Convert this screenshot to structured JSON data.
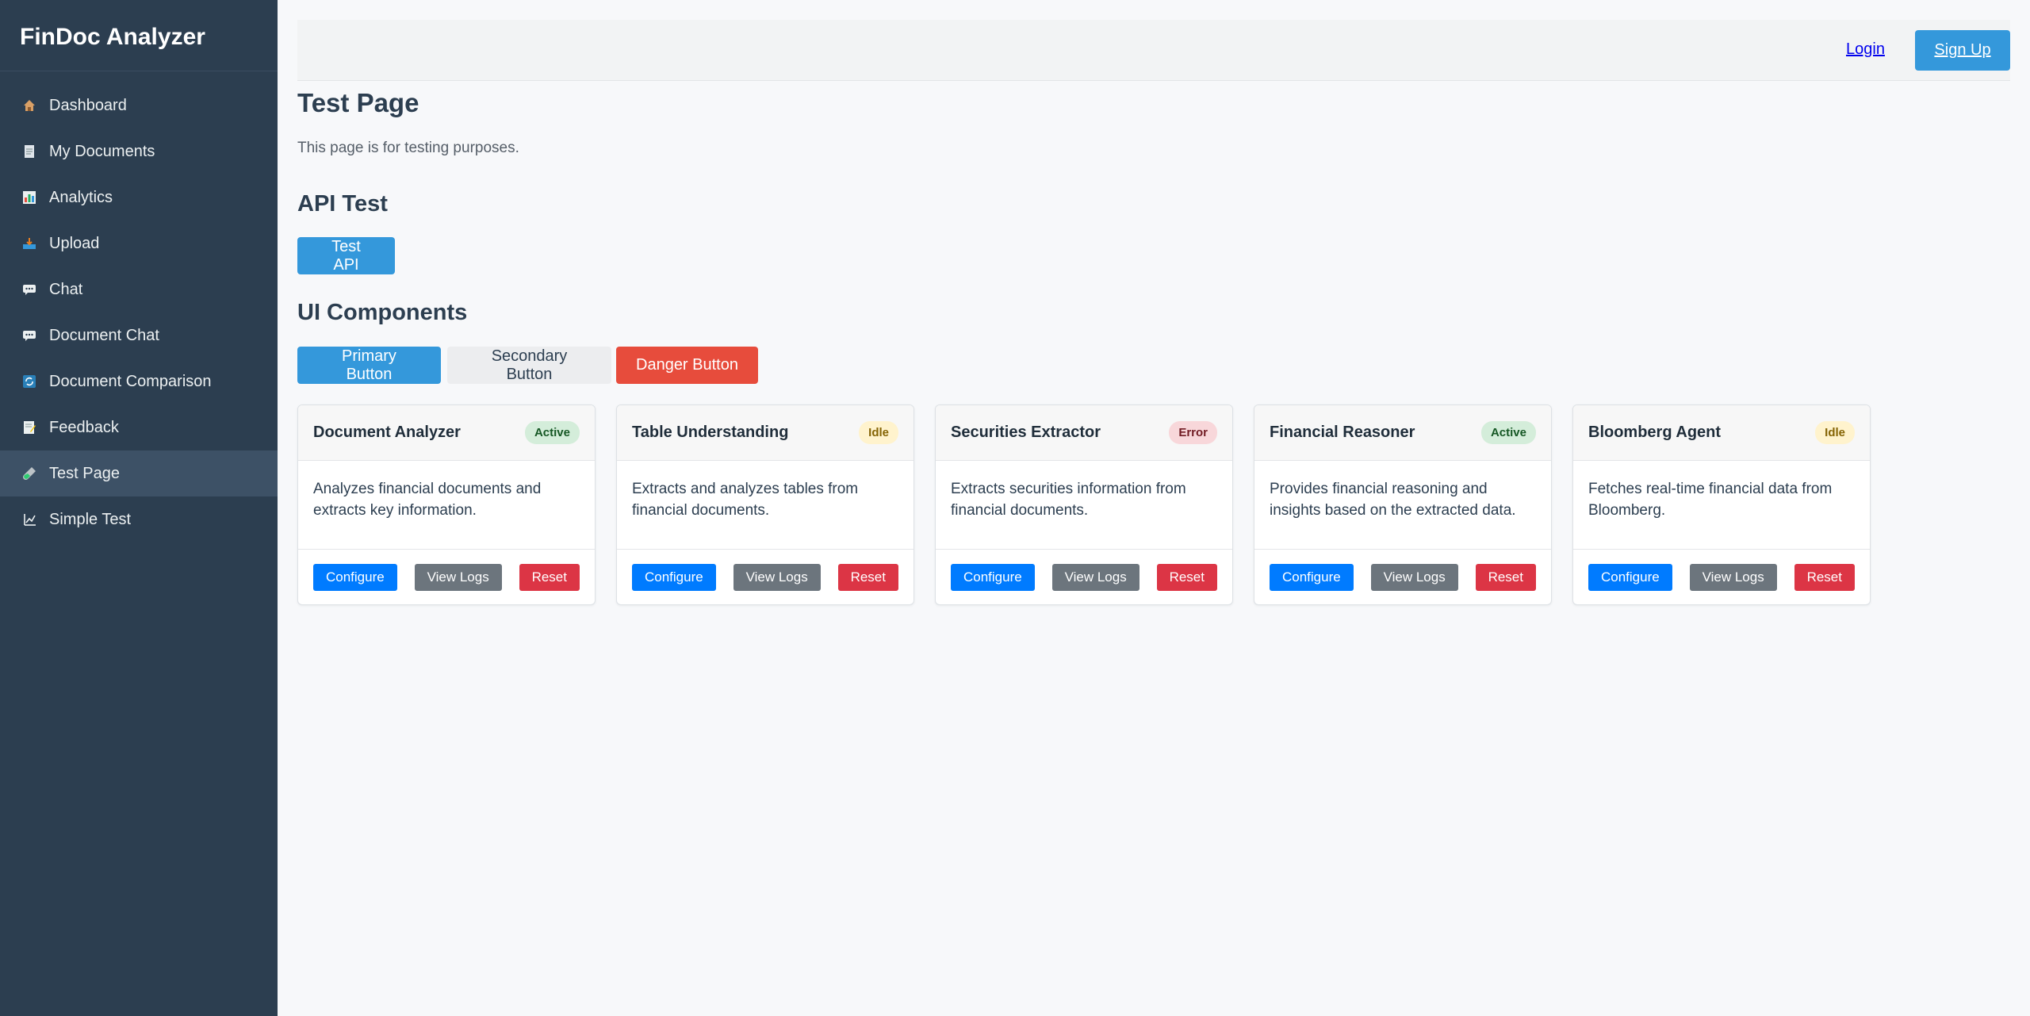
{
  "app": {
    "brand": "FinDoc Analyzer"
  },
  "sidebar": {
    "items": [
      {
        "label": "Dashboard",
        "icon": "house-icon",
        "color": "#e67e22"
      },
      {
        "label": "My Documents",
        "icon": "document-icon",
        "color": "#bdc3c7"
      },
      {
        "label": "Analytics",
        "icon": "bar-chart-icon",
        "color": "#27ae60"
      },
      {
        "label": "Upload",
        "icon": "inbox-tray-icon",
        "color": "#3498db"
      },
      {
        "label": "Chat",
        "icon": "speech-bubble-icon",
        "color": "#ecf0f1"
      },
      {
        "label": "Document Chat",
        "icon": "speech-bubble-icon",
        "color": "#ecf0f1"
      },
      {
        "label": "Document Comparison",
        "icon": "refresh-icon",
        "color": "#2980b9"
      },
      {
        "label": "Feedback",
        "icon": "memo-icon",
        "color": "#f1c40f"
      },
      {
        "label": "Test Page",
        "icon": "test-tube-icon",
        "color": "#2ecc71"
      },
      {
        "label": "Simple Test",
        "icon": "chart-increasing-icon",
        "color": "#ecf0f1"
      }
    ],
    "active_index": 8
  },
  "header": {
    "login_label": "Login",
    "signup_label": "Sign Up"
  },
  "page": {
    "title": "Test Page",
    "description": "This page is for testing purposes.",
    "api_section_title": "API Test",
    "api_button_label": "Test API",
    "ui_section_title": "UI Components",
    "primary_button_label": "Primary Button",
    "secondary_button_label": "Secondary Button",
    "danger_button_label": "Danger Button"
  },
  "agents": [
    {
      "title": "Document Analyzer",
      "status": "Active",
      "description": "Analyzes financial documents and extracts key information.",
      "configure_label": "Configure",
      "logs_label": "View Logs",
      "reset_label": "Reset"
    },
    {
      "title": "Table Understanding",
      "status": "Idle",
      "description": "Extracts and analyzes tables from financial documents.",
      "configure_label": "Configure",
      "logs_label": "View Logs",
      "reset_label": "Reset"
    },
    {
      "title": "Securities Extractor",
      "status": "Error",
      "description": "Extracts securities information from financial documents.",
      "configure_label": "Configure",
      "logs_label": "View Logs",
      "reset_label": "Reset"
    },
    {
      "title": "Financial Reasoner",
      "status": "Active",
      "description": "Provides financial reasoning and insights based on the extracted data.",
      "configure_label": "Configure",
      "logs_label": "View Logs",
      "reset_label": "Reset"
    },
    {
      "title": "Bloomberg Agent",
      "status": "Idle",
      "description": "Fetches real-time financial data from Bloomberg.",
      "configure_label": "Configure",
      "logs_label": "View Logs",
      "reset_label": "Reset"
    }
  ],
  "colors": {
    "sidebar_bg": "#2c3e50",
    "accent": "#3498db",
    "danger": "#e74c3c",
    "status_active": "#d4edda",
    "status_idle": "#fff3cd",
    "status_error": "#f8d7da"
  }
}
